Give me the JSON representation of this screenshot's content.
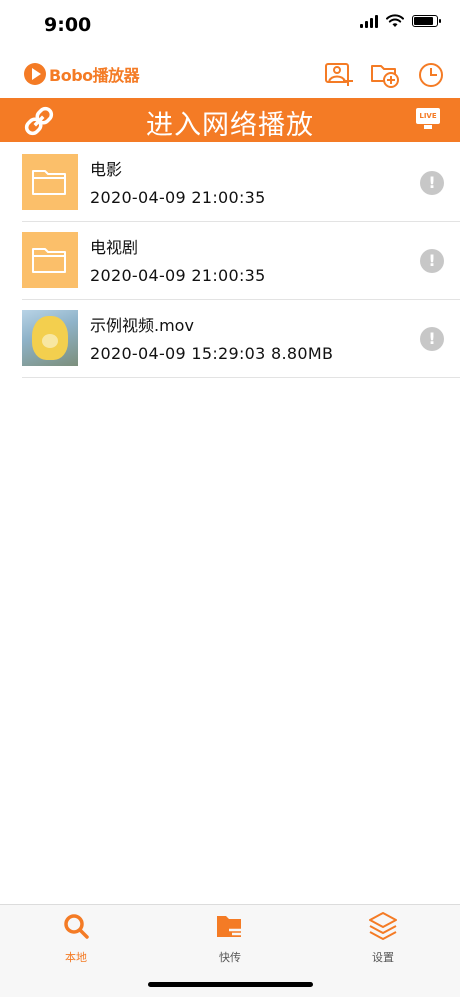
{
  "status_bar": {
    "time": "9:00"
  },
  "app": {
    "logo_text": "Bobo播放器"
  },
  "banner": {
    "title": "进入网络播放",
    "live_badge": "LIVE"
  },
  "files": [
    {
      "name": "电影",
      "meta": "2020-04-09 21:00:35",
      "kind": "folder"
    },
    {
      "name": "电视剧",
      "meta": "2020-04-09 21:00:35",
      "kind": "folder"
    },
    {
      "name": "示例视频.mov",
      "meta": "2020-04-09 15:29:03 8.80MB",
      "kind": "video"
    }
  ],
  "info_icon_glyph": "!",
  "tabs": [
    {
      "label": "本地",
      "icon": "search-icon",
      "active": true
    },
    {
      "label": "快传",
      "icon": "folder-transfer-icon",
      "active": false
    },
    {
      "label": "设置",
      "icon": "layers-icon",
      "active": false
    }
  ],
  "colors": {
    "accent": "#f47b25",
    "folder": "#fbbf6a",
    "info": "#c7c7c7"
  }
}
